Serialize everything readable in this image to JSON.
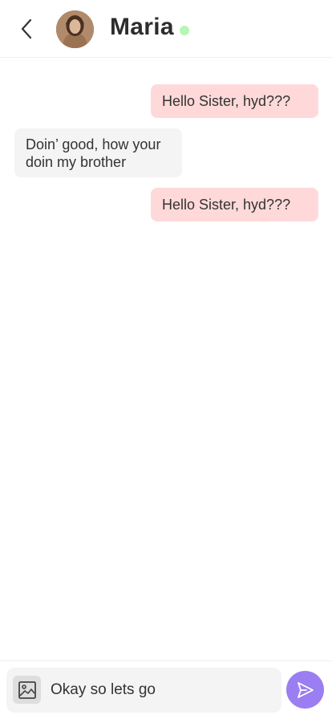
{
  "header": {
    "contact_name": "Maria",
    "back_icon": "chevron-left-icon",
    "status": "online",
    "status_color": "#b6f5b6"
  },
  "messages": [
    {
      "direction": "outgoing",
      "text": "Hello Sister, hyd???"
    },
    {
      "direction": "incoming",
      "text": "Doin’ good, how your doin my brother"
    },
    {
      "direction": "outgoing",
      "text": "Hello Sister, hyd???"
    }
  ],
  "composer": {
    "image_icon": "image-icon",
    "input_value": "Okay so lets go",
    "send_icon": "send-icon"
  },
  "colors": {
    "outgoing_bubble": "#ffd9d9",
    "incoming_bubble": "#f4f4f4",
    "send_button": "#9a7ef2",
    "online_dot": "#b6f5b6"
  }
}
